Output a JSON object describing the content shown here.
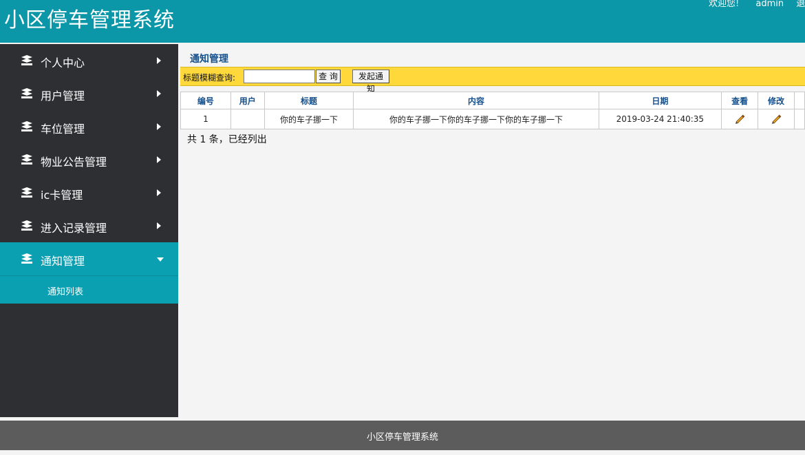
{
  "header": {
    "app_title": "小区停车管理系统",
    "welcome": "欢迎您!",
    "username": "admin",
    "logout_partial": "退"
  },
  "sidebar": {
    "items": [
      {
        "label": "个人中心",
        "icon": "stack-icon",
        "expanded": false
      },
      {
        "label": "用户管理",
        "icon": "stack-icon",
        "expanded": false
      },
      {
        "label": "车位管理",
        "icon": "stack-icon",
        "expanded": false
      },
      {
        "label": "物业公告管理",
        "icon": "stack-icon",
        "expanded": false
      },
      {
        "label": "ic卡管理",
        "icon": "stack-icon",
        "expanded": false
      },
      {
        "label": "进入记录管理",
        "icon": "stack-icon",
        "expanded": false
      },
      {
        "label": "通知管理",
        "icon": "stack-icon",
        "expanded": true
      }
    ],
    "sub_items": [
      {
        "label": "通知列表"
      }
    ]
  },
  "main": {
    "page_title": "通知管理",
    "search": {
      "label": "标题模糊查询:",
      "value": "",
      "search_button": "查 询",
      "add_button": "发起通知"
    },
    "table": {
      "columns": [
        "编号",
        "用户",
        "标题",
        "内容",
        "日期",
        "查看",
        "修改"
      ],
      "rows": [
        {
          "id": "1",
          "user": "",
          "title": "你的车子挪一下",
          "content": "你的车子挪一下你的车子挪一下你的车子挪一下",
          "date": "2019-03-24 21:40:35",
          "view_icon": "pencil-icon",
          "edit_icon": "pencil-icon"
        }
      ]
    },
    "summary": "共 1 条，已经列出"
  },
  "footer": {
    "text": "小区停车管理系统"
  },
  "colors": {
    "header_bg": "#0b97a8",
    "sidebar_bg": "#2e2f33",
    "active_bg": "#0a9fb1",
    "search_bar_bg": "#ffd83c",
    "footer_bg": "#5c5c5c",
    "title_text": "#15508c"
  }
}
